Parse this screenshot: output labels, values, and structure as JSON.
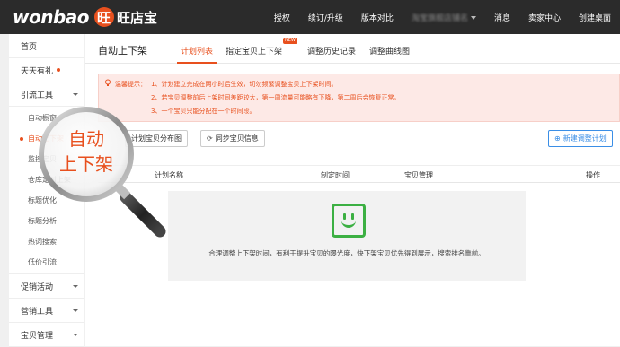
{
  "brand": {
    "logo_en": "wonbao",
    "logo_glyph": "旺",
    "logo_cn": "旺店宝"
  },
  "topnav": {
    "items": [
      "授权",
      "续订/升级",
      "版本对比"
    ],
    "user": "淘宝旗舰店铺名",
    "right_items": [
      "消息",
      "卖家中心",
      "创建桌面"
    ]
  },
  "sidebar": {
    "home": "首页",
    "daily": "天天有礼",
    "traffic": "引流工具",
    "sub_items": [
      "自动橱窗",
      "自动上下架",
      "监控宝贝",
      "仓库定时上架",
      "标题优化",
      "标题分析",
      "热词搜索",
      "低价引流"
    ],
    "promo": "促销活动",
    "marketing": "营销工具",
    "goods": "宝贝管理"
  },
  "page": {
    "title": "自动上下架",
    "tabs": [
      "计划列表",
      "指定宝贝上下架",
      "调整历史记录",
      "调整曲线图"
    ],
    "new_badge": "NEW"
  },
  "notice": {
    "label": "温馨提示：",
    "lines": [
      "1、计划建立完成在两小时后生效，切勿频繁调整宝贝上下架时间。",
      "2、若宝贝调整前后上架时间差距较大，第一周流量可能略有下降，第二周后会恢复正常。",
      "3、一个宝贝只能分配在一个时间段。"
    ]
  },
  "toolbar": {
    "distribution": "计划宝贝分布图",
    "sync": "同步宝贝信息",
    "new_plan": "新建调整计划"
  },
  "table": {
    "headers": [
      "计划名称",
      "制定时间",
      "宝贝管理",
      "操作"
    ]
  },
  "empty": {
    "message": "合理调整上下架时间，有利于提升宝贝的曝光度，快下架宝贝优先得到展示，搜索排名靠前。"
  },
  "callout": {
    "line1": "自动",
    "line2": "上下架"
  },
  "colors": {
    "accent": "#e8501e",
    "topbar": "#2b2b2b",
    "success": "#3cb043",
    "link": "#3a8ee6"
  }
}
